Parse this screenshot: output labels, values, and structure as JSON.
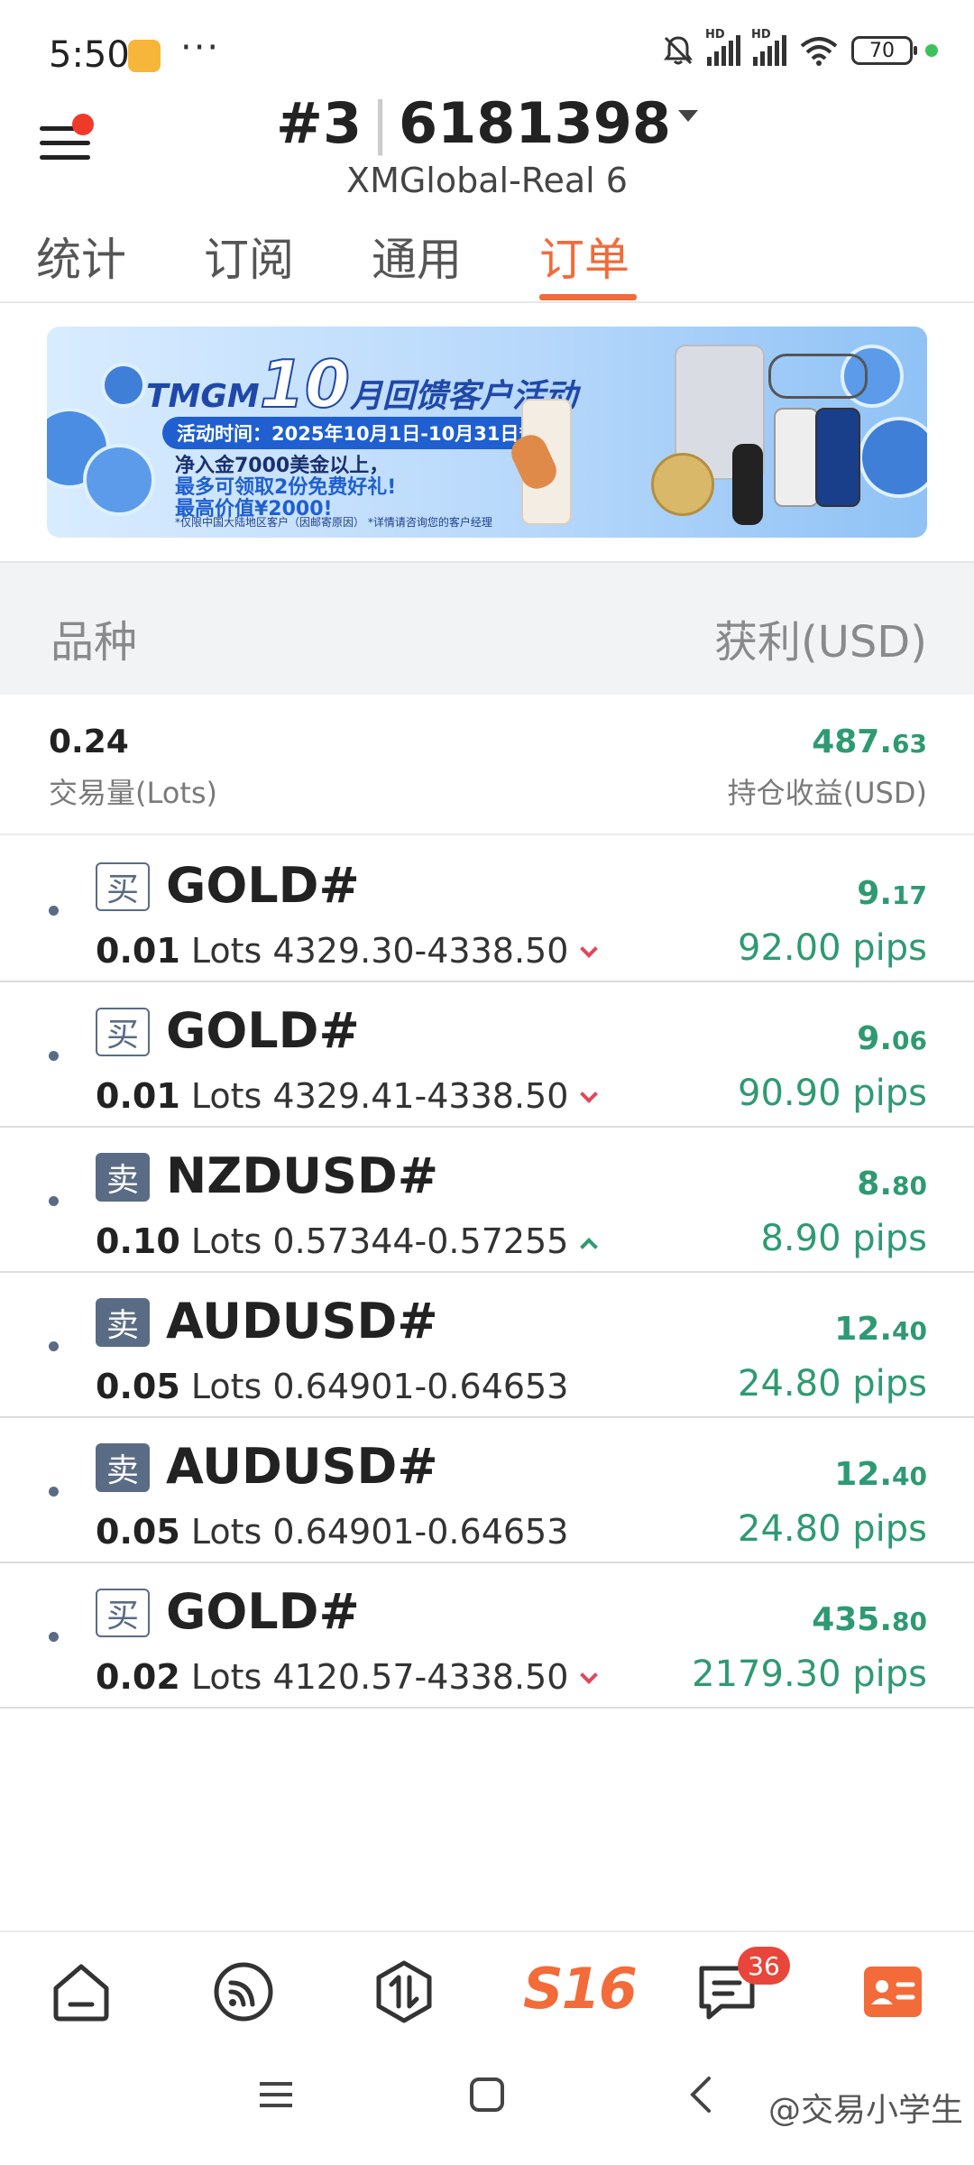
{
  "status_bar": {
    "time": "5:50",
    "dots": "···",
    "battery": "70"
  },
  "header": {
    "account_prefix": "#3",
    "account_number": "6181398",
    "server": "XMGlobal-Real 6"
  },
  "tabs": [
    {
      "label": "统计",
      "active": false
    },
    {
      "label": "订阅",
      "active": false
    },
    {
      "label": "通用",
      "active": false
    },
    {
      "label": "订单",
      "active": true
    }
  ],
  "banner": {
    "brand": "TMGM",
    "month": "10",
    "title_rest": "月回馈客户活动",
    "period": "活动时间：2025年10月1日-10月31日*",
    "line1": "净入金7000美金以上，",
    "line2": "最多可领取2份免费好礼!",
    "line3": "最高价值¥2000!",
    "note": "*仅限中国大陆地区客户（因邮寄原因）  *详情请咨询您的客户经理"
  },
  "table_header": {
    "left": "品种",
    "right": "获利(USD)"
  },
  "summary": {
    "volume": "0.24",
    "volume_label": "交易量(Lots)",
    "profit_main": "487.",
    "profit_decimals": "63",
    "profit_label": "持仓收益(USD)"
  },
  "orders": [
    {
      "side": "买",
      "side_type": "buy",
      "symbol": "GOLD#",
      "lots": "0.01",
      "lots_unit": "Lots",
      "prices": "4329.30-4338.50",
      "direction": "down",
      "profit_main": "9.",
      "profit_decimals": "17",
      "pips": "92.00 pips"
    },
    {
      "side": "买",
      "side_type": "buy",
      "symbol": "GOLD#",
      "lots": "0.01",
      "lots_unit": "Lots",
      "prices": "4329.41-4338.50",
      "direction": "down",
      "profit_main": "9.",
      "profit_decimals": "06",
      "pips": "90.90 pips"
    },
    {
      "side": "卖",
      "side_type": "sell",
      "symbol": "NZDUSD#",
      "lots": "0.10",
      "lots_unit": "Lots",
      "prices": "0.57344-0.57255",
      "direction": "up",
      "profit_main": "8.",
      "profit_decimals": "80",
      "pips": "8.90 pips"
    },
    {
      "side": "卖",
      "side_type": "sell",
      "symbol": "AUDUSD#",
      "lots": "0.05",
      "lots_unit": "Lots",
      "prices": "0.64901-0.64653",
      "direction": "none",
      "profit_main": "12.",
      "profit_decimals": "40",
      "pips": "24.80 pips"
    },
    {
      "side": "卖",
      "side_type": "sell",
      "symbol": "AUDUSD#",
      "lots": "0.05",
      "lots_unit": "Lots",
      "prices": "0.64901-0.64653",
      "direction": "none",
      "profit_main": "12.",
      "profit_decimals": "40",
      "pips": "24.80 pips"
    },
    {
      "side": "买",
      "side_type": "buy",
      "symbol": "GOLD#",
      "lots": "0.02",
      "lots_unit": "Lots",
      "prices": "4120.57-4338.50",
      "direction": "down",
      "profit_main": "435.",
      "profit_decimals": "80",
      "pips": "2179.30 pips"
    }
  ],
  "bottom_nav": {
    "items": [
      {
        "icon": "home-icon"
      },
      {
        "icon": "signal-icon"
      },
      {
        "icon": "trade-icon"
      },
      {
        "icon": "s16-logo",
        "label": "S16"
      },
      {
        "icon": "message-icon",
        "badge": "36"
      },
      {
        "icon": "profile-card-icon"
      }
    ]
  },
  "watermark": "@交易小学生",
  "colors": {
    "accent": "#f26b38",
    "profit": "#2e9a72",
    "loss": "#e0485a",
    "side_badge": "#5a6b85",
    "badge_red": "#e8463b"
  }
}
